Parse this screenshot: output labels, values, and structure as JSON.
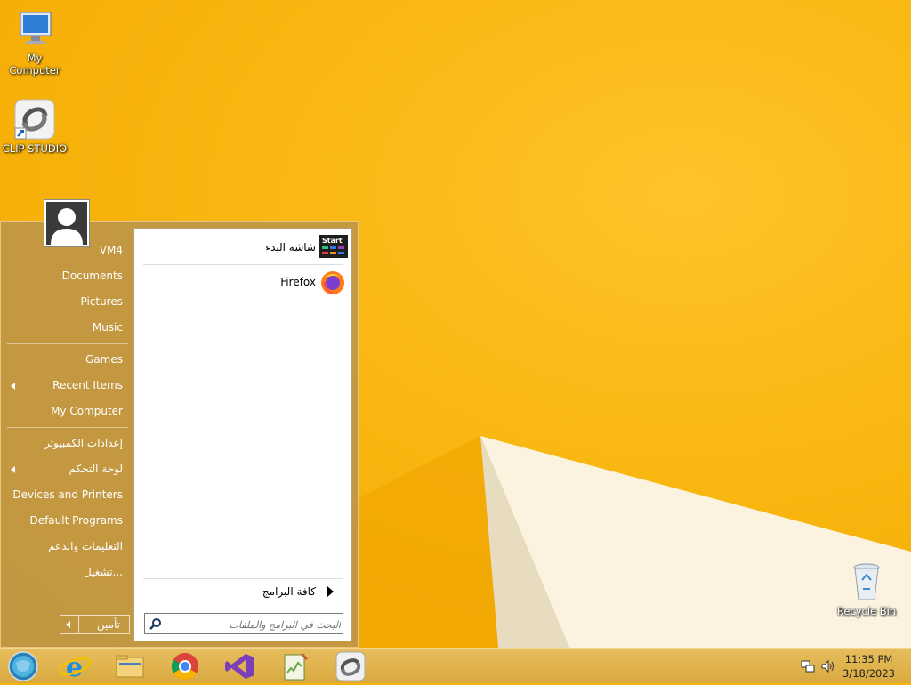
{
  "desktop": {
    "icons": [
      {
        "label": "My Computer",
        "icon": "monitor-icon"
      },
      {
        "label": "CLIP STUDIO",
        "icon": "clip-studio-icon"
      },
      {
        "label": "Recycle Bin",
        "icon": "recycle-bin-icon"
      }
    ]
  },
  "start_menu": {
    "pinned": [
      {
        "label": "شاشة البدء",
        "icon": "start-screen-icon",
        "icon_text": "Start"
      },
      {
        "label": "Firefox",
        "icon": "firefox-icon"
      }
    ],
    "all_programs_label": "كافة البرامج",
    "search_placeholder": "البحث في البرامج والملفات",
    "right_items": [
      {
        "label": "VM4",
        "has_arrow": false
      },
      {
        "label": "Documents",
        "has_arrow": false
      },
      {
        "label": "Pictures",
        "has_arrow": false
      },
      {
        "label": "Music",
        "has_arrow": false
      },
      {
        "label": "Games",
        "has_arrow": false
      },
      {
        "label": "Recent Items",
        "has_arrow": true
      },
      {
        "label": "My Computer",
        "has_arrow": false
      },
      {
        "label": "إعدادات الكمبيوتر",
        "has_arrow": false
      },
      {
        "label": "لوحة التحكم",
        "has_arrow": true
      },
      {
        "label": "Devices and Printers",
        "has_arrow": false
      },
      {
        "label": "Default Programs",
        "has_arrow": false
      },
      {
        "label": "التعليمات والدعم",
        "has_arrow": false
      },
      {
        "label": "تشغيل...",
        "has_arrow": false
      }
    ],
    "shutdown_label": "تأمين"
  },
  "taskbar": {
    "apps": [
      "start-orb-icon",
      "internet-explorer-icon",
      "file-explorer-icon",
      "chrome-icon",
      "visual-studio-icon",
      "notepad-plus-plus-icon",
      "clip-studio-icon"
    ],
    "clock": {
      "time": "11:35 PM",
      "date": "3/18/2023"
    }
  },
  "colors": {
    "accent": "#f6b40c",
    "menu_bg": "#be9646"
  }
}
